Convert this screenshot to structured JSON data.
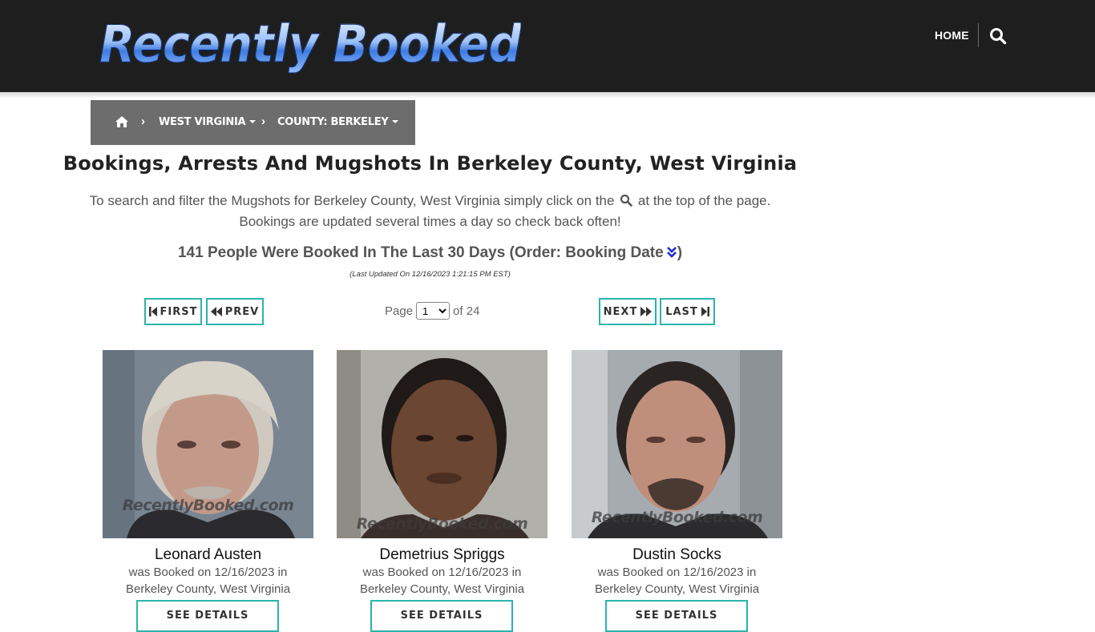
{
  "header": {
    "logo_text": "Recently Booked",
    "nav_home": "HOME",
    "search_icon": "search-icon"
  },
  "breadcrumb": {
    "home_icon": "home-icon",
    "separator": "›",
    "state": "WEST VIRGINIA",
    "county": "COUNTY: BERKELEY"
  },
  "page": {
    "title": "Bookings, Arrests And Mugshots In Berkeley County, West Virginia",
    "intro_before": "To search and filter the Mugshots for Berkeley County, West Virginia simply click on the",
    "intro_after": "at the top of the page.",
    "intro_line2": "Bookings are updated several times a day so check back often!",
    "count_text": "141 People Were Booked In The Last 30 Days (Order: Booking Date",
    "count_close": ")",
    "last_updated": "(Last Updated On 12/16/2023 1:21:15 PM EST)"
  },
  "pagination": {
    "first": "FIRST",
    "prev": "PREV",
    "next": "NEXT",
    "last": "LAST",
    "page_label": "Page",
    "current_page": "1",
    "of_label": "of 24"
  },
  "cards": [
    {
      "name": "Leonard Austen",
      "booked_line": "was Booked on 12/16/2023 in",
      "location": "Berkeley County, West Virginia",
      "watermark": "RecentlyBooked.com",
      "button": "SEE DETAILS"
    },
    {
      "name": "Demetrius Spriggs",
      "booked_line": "was Booked on 12/16/2023 in",
      "location": "Berkeley County, West Virginia",
      "watermark": "RecentlyBooked.com",
      "button": "SEE DETAILS"
    },
    {
      "name": "Dustin Socks",
      "booked_line": "was Booked on 12/16/2023 in",
      "location": "Berkeley County, West Virginia",
      "watermark": "RecentlyBooked.com",
      "button": "SEE DETAILS"
    }
  ],
  "colors": {
    "header_bg": "#1e1e1e",
    "breadcrumb_bg": "#6d6d6d",
    "accent_teal": "#2ab4ad",
    "order_icon": "#1a2bd1"
  }
}
